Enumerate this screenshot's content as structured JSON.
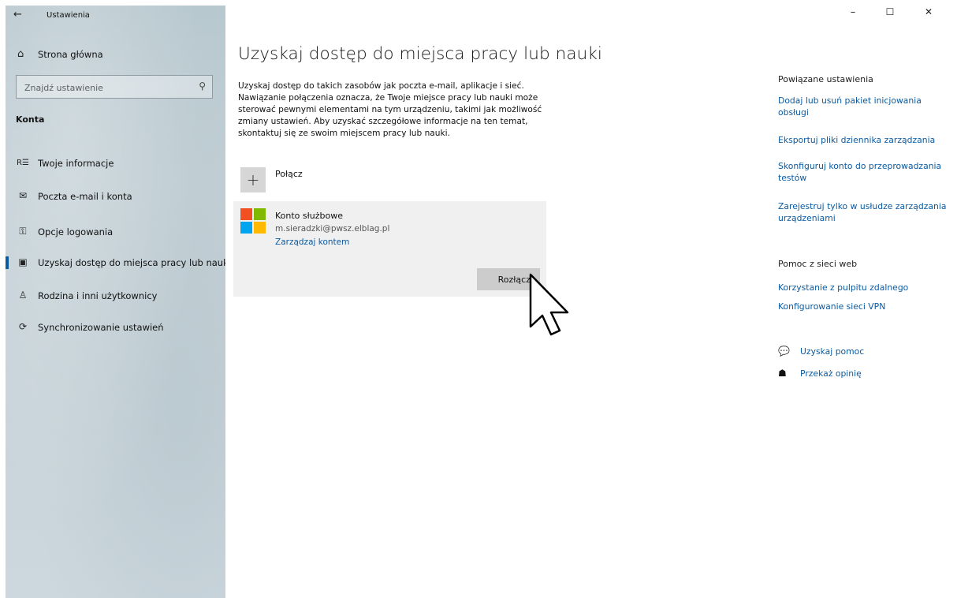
{
  "app": {
    "title": "Ustawienia",
    "back_icon": "←"
  },
  "window_controls": {
    "minimize": "–",
    "maximize": "☐",
    "close": "✕"
  },
  "sidebar": {
    "home_label": "Strona główna",
    "search_placeholder": "Znajdź ustawienie",
    "section_title": "Konta",
    "items": [
      {
        "label": "Twoje informacje",
        "icon": "person-card-icon"
      },
      {
        "label": "Poczta e-mail i konta",
        "icon": "mail-icon"
      },
      {
        "label": "Opcje logowania",
        "icon": "key-icon"
      },
      {
        "label": "Uzyskaj dostęp do miejsca pracy lub nauki",
        "icon": "briefcase-icon",
        "active": true
      },
      {
        "label": "Rodzina i inni użytkownicy",
        "icon": "add-person-icon"
      },
      {
        "label": "Synchronizowanie ustawień",
        "icon": "sync-icon"
      }
    ]
  },
  "main": {
    "title": "Uzyskaj dostęp do miejsca pracy lub nauki",
    "description": "Uzyskaj dostęp do takich zasobów jak poczta e-mail, aplikacje i sieć. Nawiązanie połączenia oznacza, że Twoje miejsce pracy lub nauki może sterować pewnymi elementami na tym urządzeniu, takimi jak możliwość zmiany ustawień. Aby uzyskać szczegółowe informacje na ten temat, skontaktuj się ze swoim miejscem pracy lub nauki.",
    "connect_label": "Połącz",
    "account": {
      "name": "Konto służbowe",
      "email": "m.sieradzki@pwsz.elblag.pl",
      "manage_link": "Zarządzaj kontem",
      "disconnect_label": "Rozłącz"
    }
  },
  "right": {
    "related_heading": "Powiązane ustawienia",
    "related_links": [
      "Dodaj lub usuń pakiet inicjowania obsługi",
      "Eksportuj pliki dziennika zarządzania",
      "Skonfiguruj konto do przeprowadzania testów",
      "Zarejestruj tylko w usłudze zarządzania urządzeniami"
    ],
    "web_help_heading": "Pomoc z sieci web",
    "web_help_links": [
      "Korzystanie z pulpitu zdalnego",
      "Konfigurowanie sieci VPN"
    ],
    "get_help": "Uzyskaj pomoc",
    "feedback": "Przekaż opinię"
  },
  "colors": {
    "accent": "#0a5aa0",
    "ms_red": "#f25022",
    "ms_green": "#7fba00",
    "ms_blue": "#00a4ef",
    "ms_yellow": "#ffb900"
  }
}
